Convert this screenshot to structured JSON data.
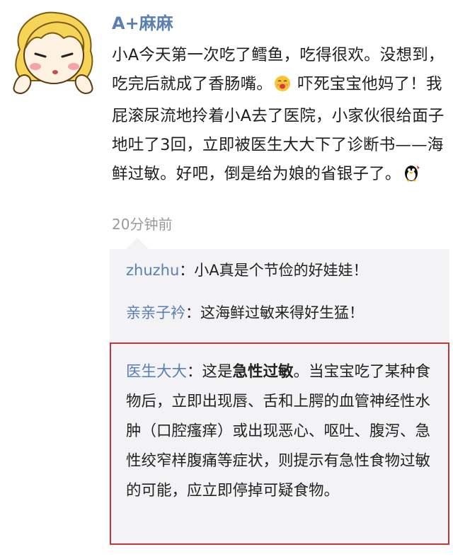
{
  "author": {
    "name": "A+麻麻"
  },
  "post": {
    "text_part1": "小A今天第一次吃了鳕鱼，吃得很欢。没想到，吃完后就成了香肠嘴。",
    "text_part2": "吓死宝宝他妈了！我屁滚尿流地拎着小A去了医院，小家伙很给面子地吐了3回，立即被医生大大下了诊断书——海鲜过敏。好吧，倒是给为娘的省银子了。",
    "emoji_1": "blush-face-icon",
    "emoji_2": "penguin-icon",
    "time": "20分钟前"
  },
  "comments": [
    {
      "name": "zhuzhu",
      "sep": "：",
      "text": "小A真是个节俭的好娃娃！"
    },
    {
      "name": "亲亲子衿",
      "sep": "：",
      "text": "这海鲜过敏来得好生猛！"
    },
    {
      "name": "医生大大",
      "sep": "：",
      "text_pre": "这是",
      "text_bold": "急性过敏",
      "text_post": "。当宝宝吃了某种食物后，立即出现唇、舌和上腭的血管神经性水肿（口腔瘙痒）或出现恶心、呕吐、腹泻、急性绞窄样腹痛等症状，则提示有急性食物过敏的可能，应立即停掉可疑食物。"
    }
  ],
  "colors": {
    "name": "#5a7fb2",
    "highlight_border": "#b93b3b",
    "comment_bg": "#f3f3f5"
  }
}
